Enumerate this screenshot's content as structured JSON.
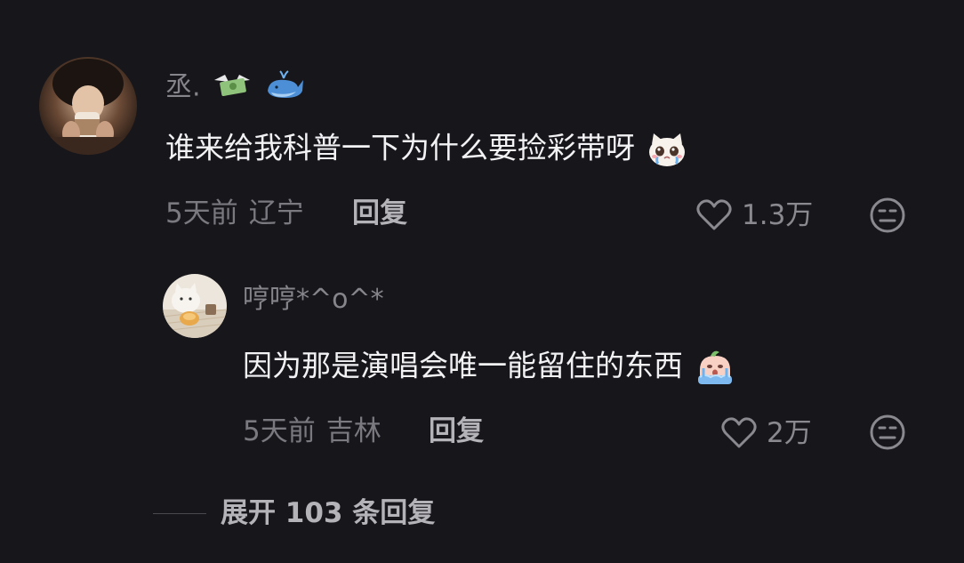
{
  "comments": [
    {
      "username": "丞.",
      "username_badges": [
        "money-with-wings-emoji",
        "whale-emoji"
      ],
      "text": "谁来给我科普一下为什么要捡彩带呀",
      "text_emoji": "crying-cat-emoji",
      "time": "5天前",
      "location": "辽宁",
      "reply_label": "回复",
      "likes": "1.3万",
      "avatar": "person-drinking-coffee-avatar"
    },
    {
      "username": "哼哼*^o^*",
      "text": "因为那是演唱会唯一能留住的东西",
      "text_emoji": "crying-face-emoji",
      "time": "5天前",
      "location": "吉林",
      "reply_label": "回复",
      "likes": "2万",
      "avatar": "cat-and-food-avatar"
    }
  ],
  "expand_replies_label": "展开 103 条回复",
  "colors": {
    "background": "#17161b",
    "text_primary": "#f2f2f4",
    "text_secondary": "#7a7980",
    "reply_text": "#b4b3b8"
  }
}
